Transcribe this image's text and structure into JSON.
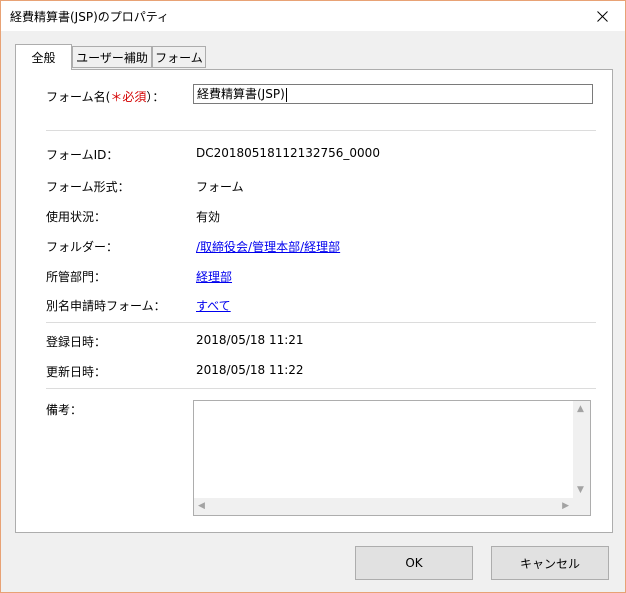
{
  "window": {
    "title": "経費精算書(JSP)のプロパティ"
  },
  "tabs": [
    {
      "label": "全般"
    },
    {
      "label": "ユーザー補助"
    },
    {
      "label": "フォーム"
    }
  ],
  "form": {
    "name_label_prefix": "フォーム名(",
    "required_mark": "＊必須",
    "name_label_suffix": "）：",
    "name_value": "経費精算書(JSP)",
    "form_id_label": "フォームID：",
    "form_id_value": "DC20180518112132756_0000",
    "form_type_label": "フォーム形式：",
    "form_type_value": "フォーム",
    "usage_label": "使用状況：",
    "usage_value": "有効",
    "folder_label": "フォルダー：",
    "folder_value": "/取締役会/管理本部/経理部",
    "dept_label": "所管部門：",
    "dept_value": "経理部",
    "alias_label": "別名申請時フォーム：",
    "alias_value": "すべて",
    "registered_label": "登録日時：",
    "registered_value": "2018/05/18 11:21",
    "updated_label": "更新日時：",
    "updated_value": "2018/05/18 11:22",
    "notes_label": "備考："
  },
  "buttons": {
    "ok": "OK",
    "cancel": "キャンセル"
  }
}
